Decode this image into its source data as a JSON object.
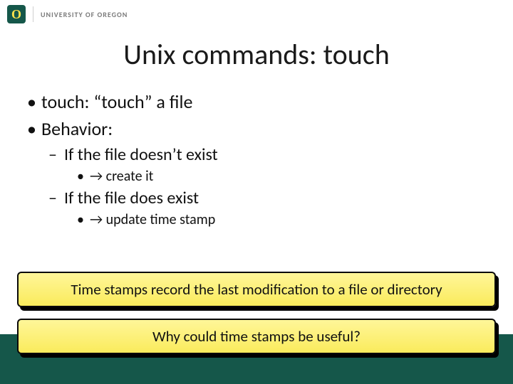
{
  "header": {
    "logo_letter": "O",
    "university": "UNIVERSITY OF OREGON"
  },
  "title": "Unix commands: touch",
  "bullets": {
    "l1a": "touch: “touch” a file",
    "l1b": "Behavior:",
    "l2a": "If the file doesn’t exist",
    "l3a": "→ create it",
    "l2b": "If the file does exist",
    "l3b": "→ update time stamp"
  },
  "callouts": {
    "box1": "Time stamps record the last modification to a file or directory",
    "box2": "Why could time stamps be useful?"
  }
}
